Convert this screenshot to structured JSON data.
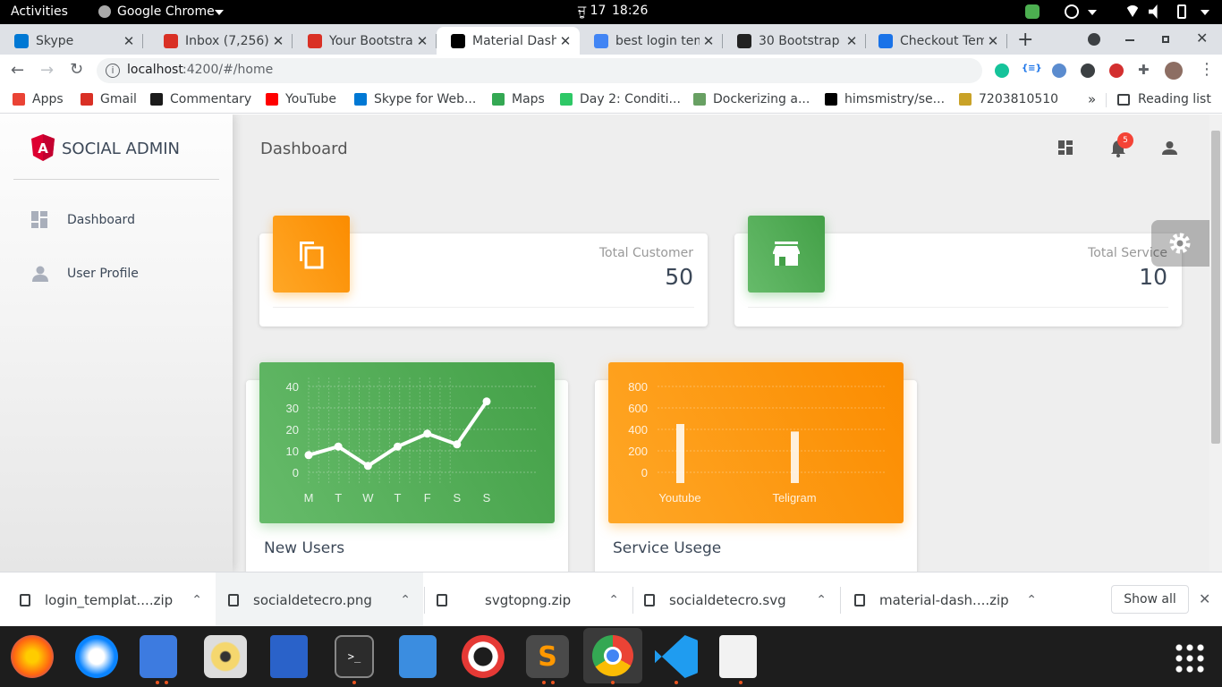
{
  "system_bar": {
    "activities": "Activities",
    "app_name": "Google Chrome",
    "date": "ਜੂ 17",
    "time": "18:26"
  },
  "tabs": [
    {
      "title": "Skype",
      "icon": "skype-icon",
      "color": "#0078d4",
      "active": false
    },
    {
      "title": "Inbox (7,256) -",
      "icon": "gmail-icon",
      "color": "#d93025",
      "active": false
    },
    {
      "title": "Your Bootstra",
      "icon": "gmail-icon",
      "color": "#d93025",
      "active": false
    },
    {
      "title": "Material Dash",
      "icon": "bow-tie-icon",
      "color": "#000000",
      "active": true
    },
    {
      "title": "best login tem",
      "icon": "google-icon",
      "color": "#4285f4",
      "active": false
    },
    {
      "title": "30 Bootstrap",
      "icon": "f-icon",
      "color": "#222222",
      "active": false
    },
    {
      "title": "Checkout Tem",
      "icon": "grid-icon",
      "color": "#1a73e8",
      "active": false
    }
  ],
  "address": {
    "host": "localhost",
    "path": ":4200/#/home"
  },
  "bookmarks": [
    {
      "label": "Apps",
      "icon": "apps-grid-icon",
      "color": "#ea4335"
    },
    {
      "label": "Gmail",
      "icon": "gmail-icon",
      "color": "#d93025"
    },
    {
      "label": "Commentary",
      "icon": "cricbuzz-icon",
      "color": "#1b1b1b"
    },
    {
      "label": "YouTube",
      "icon": "youtube-icon",
      "color": "#ff0000"
    },
    {
      "label": "Skype for Web...",
      "icon": "skype-icon",
      "color": "#0078d4"
    },
    {
      "label": "Maps",
      "icon": "maps-pin-icon",
      "color": "#34a853"
    },
    {
      "label": "Day 2: Conditi...",
      "icon": "hackerrank-icon",
      "color": "#2ec866"
    },
    {
      "label": "Dockerizing a...",
      "icon": "node-icon",
      "color": "#68a063"
    },
    {
      "label": "himsmistry/se...",
      "icon": "github-icon",
      "color": "#000000"
    },
    {
      "label": "7203810510",
      "icon": "bookmark-page-icon",
      "color": "#c9a227"
    }
  ],
  "reading_list": "Reading list",
  "app": {
    "brand": "SOCIAL ADMIN",
    "page_title": "Dashboard",
    "notification_count": "5",
    "nav": [
      {
        "label": "Dashboard",
        "icon": "dashboard-icon"
      },
      {
        "label": "User Profile",
        "icon": "person-icon"
      }
    ],
    "stats": [
      {
        "label": "Total Customer",
        "value": "50",
        "icon": "content-copy-icon",
        "color": "#fb8c00"
      },
      {
        "label": "Total Service",
        "value": "10",
        "icon": "store-icon",
        "color": "#43a047"
      }
    ],
    "charts": [
      {
        "title": "New Users",
        "color": "#4caf50"
      },
      {
        "title": "Service Usege",
        "color": "#ff9800"
      }
    ]
  },
  "chart_data": [
    {
      "type": "line",
      "categories": [
        "M",
        "T",
        "W",
        "T",
        "F",
        "S",
        "S"
      ],
      "values": [
        8,
        12,
        3,
        12,
        18,
        13,
        33
      ],
      "ylim": [
        0,
        40
      ],
      "yticks": [
        "40",
        "30",
        "20",
        "10",
        "0"
      ],
      "grid": true,
      "title": "New Users"
    },
    {
      "type": "bar",
      "categories": [
        "Youtube",
        "Teligram"
      ],
      "values": [
        450,
        380
      ],
      "ylim": [
        0,
        800
      ],
      "yticks": [
        "800",
        "600",
        "400",
        "200",
        "0"
      ],
      "grid": true,
      "title": "Service Usege"
    }
  ],
  "downloads": [
    {
      "name": "login_templat....zip",
      "icon": "file-icon"
    },
    {
      "name": "socialdetecro.png",
      "icon": "image-icon"
    },
    {
      "name": "svgtopng.zip",
      "icon": "file-icon"
    },
    {
      "name": "socialdetecro.svg",
      "icon": "image-icon"
    },
    {
      "name": "material-dash....zip",
      "icon": "file-icon"
    }
  ],
  "show_all": "Show all"
}
